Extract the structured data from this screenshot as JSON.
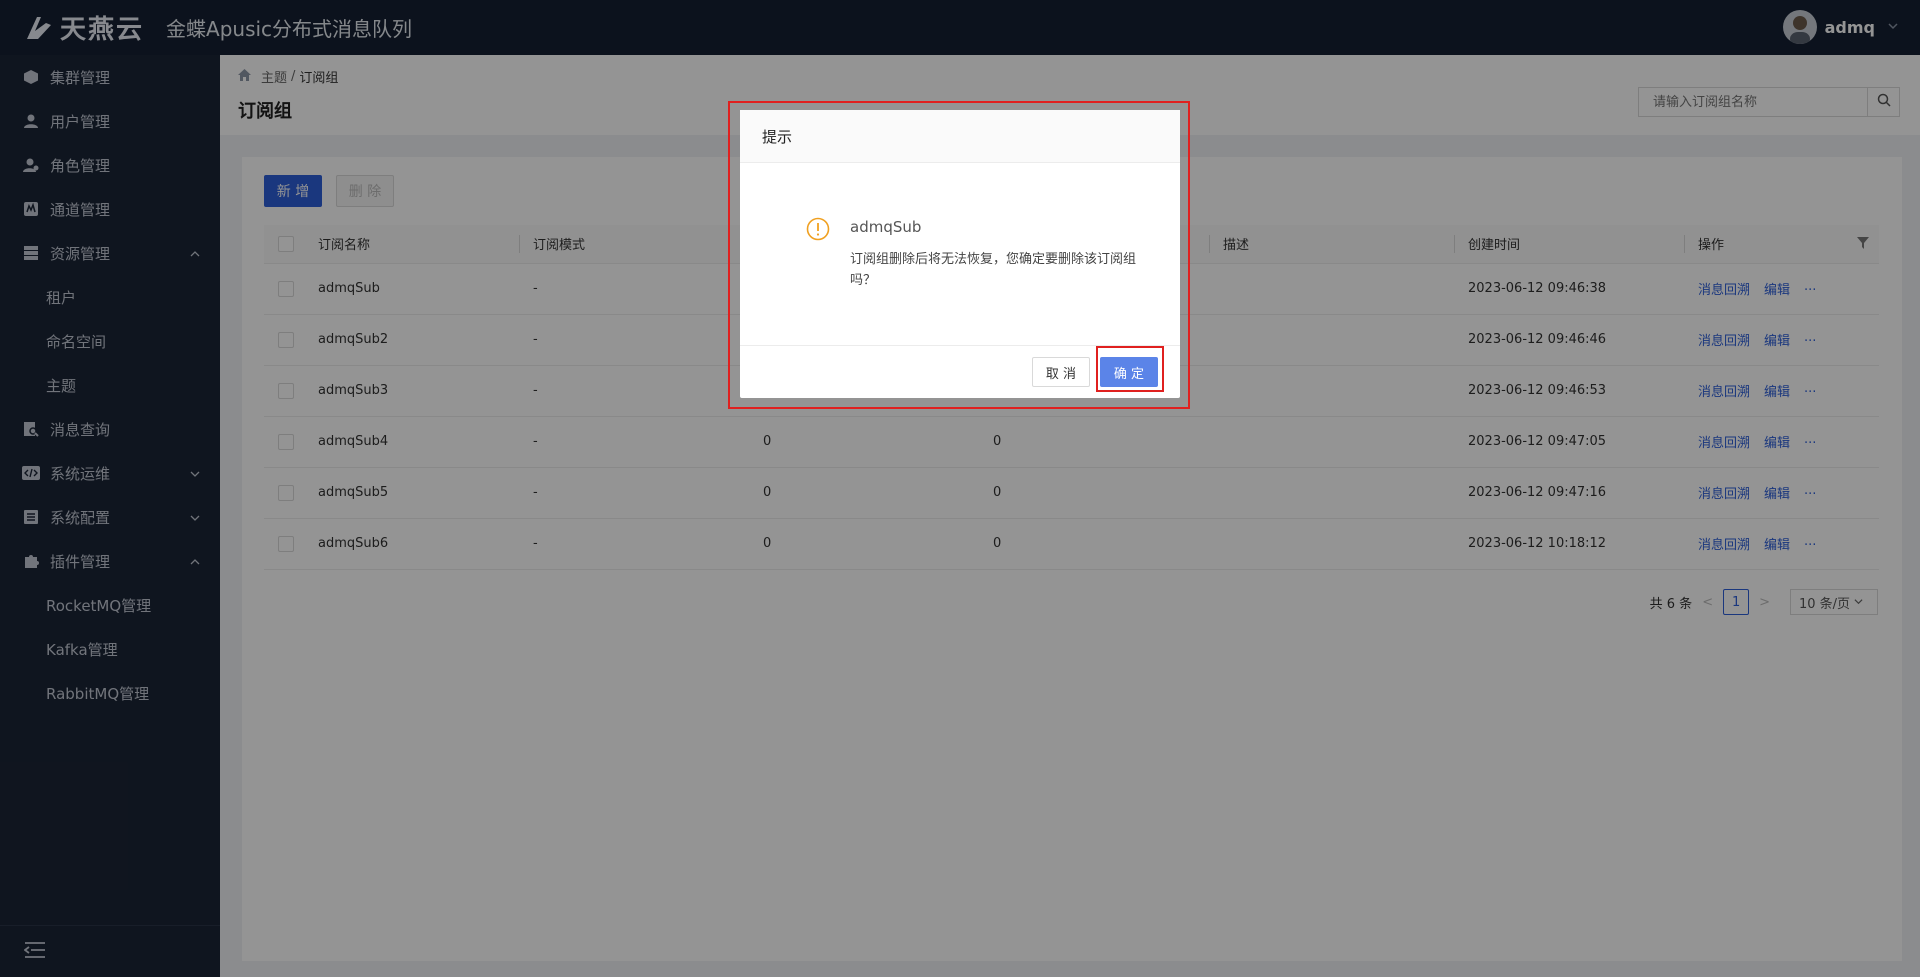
{
  "header": {
    "logo_text": "天燕云",
    "app_title": "金蝶Apusic分布式消息队列",
    "user_name": "admq"
  },
  "sidebar": {
    "items": [
      {
        "label": "集群管理",
        "icon": "cube-icon"
      },
      {
        "label": "用户管理",
        "icon": "user-icon"
      },
      {
        "label": "角色管理",
        "icon": "role-icon"
      },
      {
        "label": "通道管理",
        "icon": "channel-icon"
      },
      {
        "label": "资源管理",
        "icon": "server-icon",
        "expanded": true,
        "children": [
          "租户",
          "命名空间",
          "主题"
        ]
      },
      {
        "label": "消息查询",
        "icon": "doc-search-icon"
      },
      {
        "label": "系统运维",
        "icon": "code-icon",
        "expanded": false
      },
      {
        "label": "系统配置",
        "icon": "list-icon",
        "expanded": false
      },
      {
        "label": "插件管理",
        "icon": "puzzle-icon",
        "expanded": true,
        "children": [
          "RocketMQ管理",
          "Kafka管理",
          "RabbitMQ管理"
        ]
      }
    ]
  },
  "breadcrumb": {
    "parent": "主题",
    "separator": "/",
    "current": "订阅组"
  },
  "page_title": "订阅组",
  "search": {
    "placeholder": "请输入订阅组名称"
  },
  "toolbar": {
    "add_label": "新 增",
    "delete_label": "删 除"
  },
  "table": {
    "columns": [
      "订阅名称",
      "订阅模式",
      "",
      "",
      "描述",
      "创建时间",
      "操作"
    ],
    "rows": [
      {
        "name": "admqSub",
        "mode": "-",
        "c3": "",
        "c4": "",
        "desc": "",
        "created": "2023-06-12 09:46:38"
      },
      {
        "name": "admqSub2",
        "mode": "-",
        "c3": "",
        "c4": "",
        "desc": "",
        "created": "2023-06-12 09:46:46"
      },
      {
        "name": "admqSub3",
        "mode": "-",
        "c3": "",
        "c4": "",
        "desc": "",
        "created": "2023-06-12 09:46:53"
      },
      {
        "name": "admqSub4",
        "mode": "-",
        "c3": "0",
        "c4": "0",
        "desc": "",
        "created": "2023-06-12 09:47:05"
      },
      {
        "name": "admqSub5",
        "mode": "-",
        "c3": "0",
        "c4": "0",
        "desc": "",
        "created": "2023-06-12 09:47:16"
      },
      {
        "name": "admqSub6",
        "mode": "-",
        "c3": "0",
        "c4": "0",
        "desc": "",
        "created": "2023-06-12 10:18:12"
      }
    ],
    "actions": {
      "trace": "消息回溯",
      "edit": "编辑",
      "more": "···"
    }
  },
  "pagination": {
    "total": "共 6 条",
    "page": "1",
    "page_size": "10 条/页"
  },
  "dialog": {
    "title": "提示",
    "name": "admqSub",
    "message": "订阅组删除后将无法恢复，您确定要删除该订阅组吗？",
    "cancel_label": "取 消",
    "ok_label": "确 定"
  },
  "colors": {
    "header_bg": "#152033",
    "sidebar_bg": "#1b2536",
    "primary": "#2e5fd9",
    "highlight": "#e0201f",
    "warning": "#f0a020"
  }
}
